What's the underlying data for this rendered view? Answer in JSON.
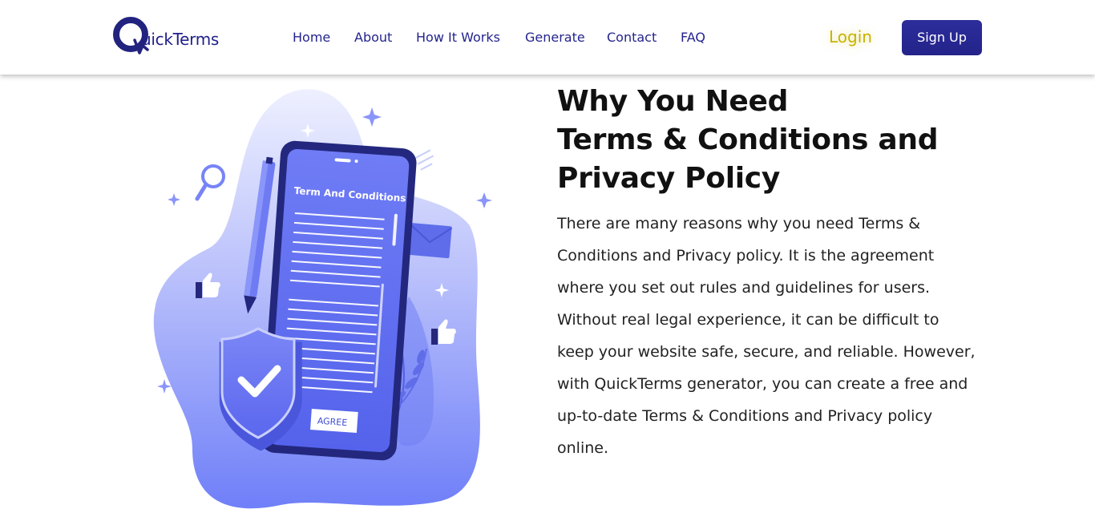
{
  "header": {
    "logo_text": "uickTerms",
    "nav": [
      {
        "label": "Home",
        "name": "nav-home"
      },
      {
        "label": "About",
        "name": "nav-about"
      },
      {
        "label": "How It Works",
        "name": "nav-how-it-works"
      },
      {
        "label": "Generate",
        "name": "nav-generate"
      },
      {
        "label": "Contact",
        "name": "nav-contact"
      },
      {
        "label": "FAQ",
        "name": "nav-faq"
      }
    ],
    "login_label": "Login",
    "signup_label": "Sign Up"
  },
  "illustration": {
    "document_title": "Term And Conditions",
    "agree_label": "AGREE"
  },
  "section": {
    "heading_lines": [
      "Why You Need",
      "Terms & Conditions and",
      "Privacy Policy"
    ],
    "paragraph_lines": [
      "There are many reasons why you need Terms &",
      "Conditions and Privacy policy. It is the agreement",
      "where you set out rules and guidelines for users.",
      "Without real legal experience, it can be difficult to",
      "keep your website safe, secure, and reliable. However,",
      "with QuickTerms generator, you can create a free and",
      "up-to-date Terms & Conditions and Privacy policy",
      "online."
    ]
  },
  "colors": {
    "brand_navy": "#24248f",
    "signup_bg": "#2d2d9c",
    "login_yellow": "#c7b300",
    "illustration_blue": "#6f7cf7"
  }
}
